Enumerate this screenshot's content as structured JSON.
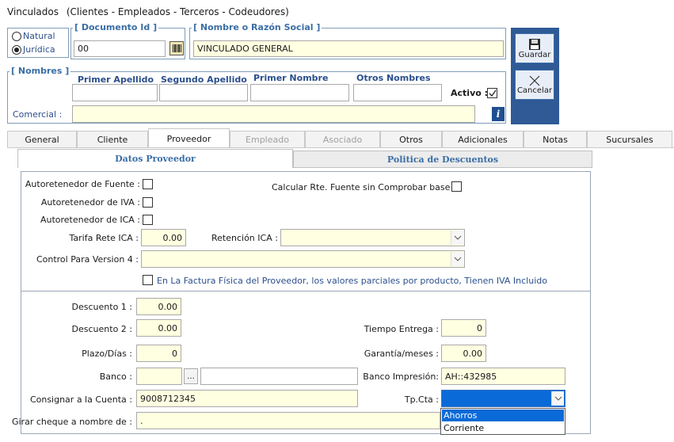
{
  "window": {
    "title": "Vinculados",
    "subtitle": "(Clientes - Empleados - Terceros - Codeudores)"
  },
  "person_type": {
    "natural_label": "Natural",
    "juridica_label": "Jurídica",
    "selected": "juridica"
  },
  "documento": {
    "legend": "[ Documento Id ]",
    "value": "00"
  },
  "nombre": {
    "legend": "[ Nombre o Razón Social ]",
    "value": "VINCULADO GENERAL"
  },
  "nombres": {
    "legend": "[ Nombres ]",
    "primer_apellido": "Primer Apellido",
    "segundo_apellido": "Segundo Apellido",
    "primer_nombre": "Primer Nombre",
    "otros_nombres": "Otros Nombres",
    "activo_label": "Activo :",
    "comercial_label": "Comercial :"
  },
  "actions": {
    "guardar": "Guardar",
    "cancelar": "Cancelar"
  },
  "tabs": [
    {
      "label": "General",
      "state": "normal"
    },
    {
      "label": "Cliente",
      "state": "normal"
    },
    {
      "label": "Proveedor",
      "state": "active"
    },
    {
      "label": "Empleado",
      "state": "disabled"
    },
    {
      "label": "Asociado",
      "state": "disabled"
    },
    {
      "label": "Otros",
      "state": "normal"
    },
    {
      "label": "Adicionales",
      "state": "normal"
    },
    {
      "label": "Notas",
      "state": "normal"
    },
    {
      "label": "Sucursales",
      "state": "normal"
    }
  ],
  "subtabs": {
    "datos": "Datos Proveedor",
    "politica": "Politica de Descuentos"
  },
  "proveedor": {
    "autoret_fuente": "Autoretenedor de Fuente :",
    "autoret_iva": "Autoretenedor de IVA :",
    "autoret_ica": "Autoretenedor de ICA :",
    "calcular_rte": "Calcular Rte. Fuente sin Comprobar base :",
    "tarifa_label": "Tarifa Rete ICA :",
    "tarifa_value": "0.00",
    "retencion_label": "Retención ICA :",
    "control_label": "Control Para Version 4 :",
    "factura_note": "En La Factura Física del Proveedor, los valores parciales  por producto, Tienen IVA Incluido"
  },
  "descuentos": {
    "descuento1_label": "Descuento 1 :",
    "descuento1_value": "0.00",
    "descuento2_label": "Descuento 2 :",
    "descuento2_value": "0.00",
    "plazo_label": "Plazo/Días :",
    "plazo_value": "0",
    "banco_label": "Banco :",
    "banco_btn": "...",
    "consignar_label": "Consignar a la Cuenta :",
    "consignar_value": "9008712345",
    "girar_label": "Girar cheque a nombre de :",
    "girar_value": ".",
    "tiempo_label": "Tiempo Entrega :",
    "tiempo_value": "0",
    "garantia_label": "Garantía/meses :",
    "garantia_value": "0.00",
    "banco_imp_label": "Banco Impresión:",
    "banco_imp_value": "AH::432985",
    "tpcta_label": "Tp.Cta :",
    "tpcta_options": [
      "Ahorros",
      "Corriente"
    ]
  }
}
